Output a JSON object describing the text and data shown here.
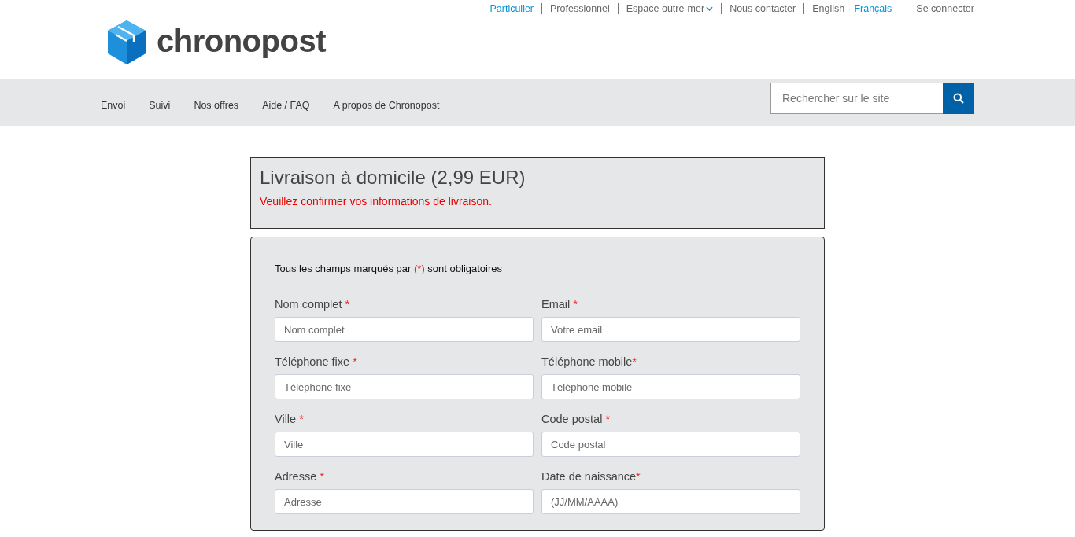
{
  "top_links": [
    {
      "kind": "link",
      "label": "Particulier",
      "selected": true
    },
    {
      "kind": "link",
      "label": "Professionnel",
      "selected": false
    },
    {
      "kind": "dropdown",
      "label": "Espace outre-mer",
      "selected": false
    },
    {
      "kind": "link",
      "label": "Nous contacter",
      "selected": false
    },
    {
      "kind": "language",
      "separator": "-",
      "options": [
        {
          "label": "English",
          "selected": false
        },
        {
          "label": "Français",
          "selected": true
        }
      ]
    },
    {
      "kind": "login",
      "label": "Se connecter",
      "selected": false
    }
  ],
  "logo": {
    "name": "chronopost"
  },
  "nav": [
    "Envoi",
    "Suivi",
    "Nos offres",
    "Aide / FAQ",
    "A propos de Chronopost"
  ],
  "search": {
    "placeholder": "Rechercher sur le site"
  },
  "delivery": {
    "title": "Livraison à domicile (2,99 EUR)",
    "message": "Veuillez confirmer vos informations de livraison."
  },
  "form": {
    "intro": {
      "before": "Tous les champs marqués par",
      "mark": "(*)",
      "after": "sont obligatoires"
    },
    "fields": [
      {
        "label": "Nom complet",
        "mark": " *",
        "placeholder": "Nom complet"
      },
      {
        "label": "Email",
        "mark": " *",
        "placeholder": "Votre email"
      },
      {
        "label": "Téléphone fixe",
        "mark": " *",
        "placeholder": "Téléphone fixe"
      },
      {
        "label": "Téléphone mobile",
        "mark": "*",
        "placeholder": "Téléphone mobile"
      },
      {
        "label": "Ville",
        "mark": " *",
        "placeholder": "Ville"
      },
      {
        "label": "Code postal",
        "mark": " *",
        "placeholder": "Code postal"
      },
      {
        "label": "Adresse",
        "mark": " *",
        "placeholder": "Adresse"
      },
      {
        "label": "Date de naissance",
        "mark": "*",
        "placeholder": "(JJ/MM/AAAA)"
      }
    ]
  }
}
